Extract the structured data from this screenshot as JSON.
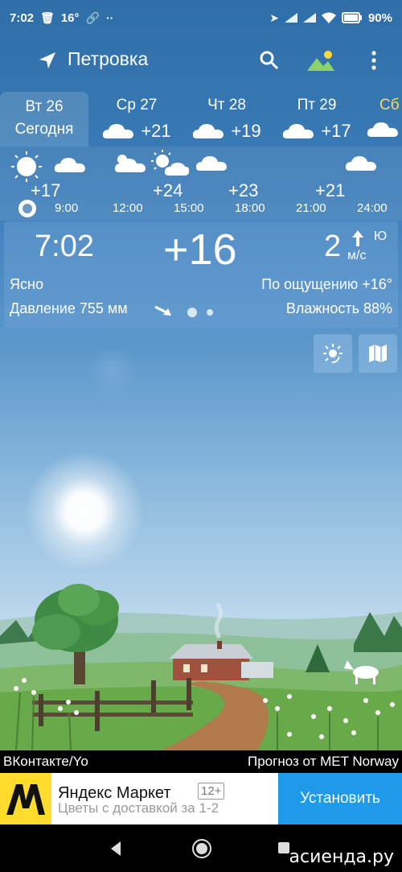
{
  "status_bar": {
    "time": "7:02",
    "temp_indicator": "16°",
    "battery": "90%",
    "icons": [
      "trash-icon",
      "link-icon",
      "more-dots-icon",
      "location-arrow-icon",
      "signal-icon",
      "signal-icon",
      "wifi-icon",
      "battery-icon"
    ]
  },
  "app_bar": {
    "city": "Петровка",
    "icons": [
      "navigation-arrow-icon",
      "search-icon",
      "landscape-gallery-icon",
      "more-vert-icon"
    ]
  },
  "days": [
    {
      "name": "Вт 26",
      "subtitle": "Сегодня",
      "selected": true
    },
    {
      "name": "Ср 27",
      "temp": "+21",
      "icon": "cloud-icon"
    },
    {
      "name": "Чт 28",
      "temp": "+19",
      "icon": "cloud-icon"
    },
    {
      "name": "Пт 29",
      "temp": "+17",
      "icon": "cloud-icon"
    },
    {
      "name": "Сб",
      "temp": "",
      "icon": "cloud-icon"
    }
  ],
  "hourly": {
    "temps": [
      "+17",
      "+24",
      "+23",
      "+21"
    ],
    "times": [
      "9:00",
      "12:00",
      "15:00",
      "18:00",
      "21:00",
      "24:00"
    ]
  },
  "current": {
    "time": "7:02",
    "temp": "+16",
    "wind_speed": "2",
    "wind_dir": "Ю",
    "wind_unit": "м/с",
    "condition": "Ясно",
    "feels_like": "По ощущению +16°",
    "pressure": "Давление 755 мм",
    "humidity": "Влажность 88%",
    "page_dots": 2
  },
  "footer": {
    "left": "ВКонтакте/Yo",
    "right": "Прогноз от MET Norway"
  },
  "ad": {
    "title": "Яндекс Маркет",
    "age": "12+",
    "subtitle": "Цветы с доставкой за 1-2",
    "cta": "Установить",
    "brand_color": "#ffdb2d",
    "cta_color": "#1e9ae8"
  },
  "watermark": "асиенда.ру"
}
